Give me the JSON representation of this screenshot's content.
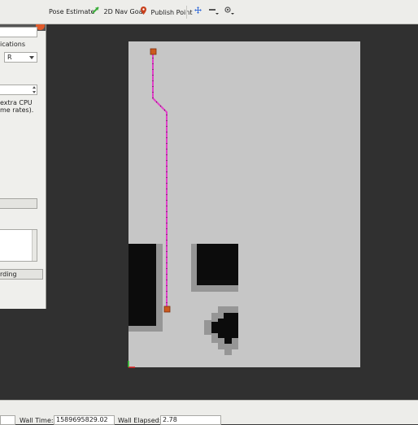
{
  "toolbar": {
    "pose_estimate_label": "Pose Estimate",
    "nav_goal_label": "2D Nav Goal",
    "publish_point_label": "Publish Point",
    "icons": [
      "pose-estimate-icon",
      "nav-goal-icon",
      "publish-point-icon",
      "move-camera-icon",
      "zoom-icon",
      "eye-icon"
    ]
  },
  "panel": {
    "notifications_text": "ications",
    "dropdown_value": "R",
    "cpu_text_1": "extra CPU",
    "cpu_text_2": "me rates).",
    "recording_button_label": "rding"
  },
  "status": {
    "wall_time_label": "Wall Time:",
    "wall_time_value": "1589695829.02",
    "wall_elapsed_label": "Wall Elapsed:",
    "wall_elapsed_value": "2.78"
  },
  "colors": {
    "path": "#e040c8",
    "map_free": "#c6c6c6",
    "obstacle": "#0c0c0c",
    "inflation": "#969696",
    "pose_marker": "#cc5a1e"
  }
}
